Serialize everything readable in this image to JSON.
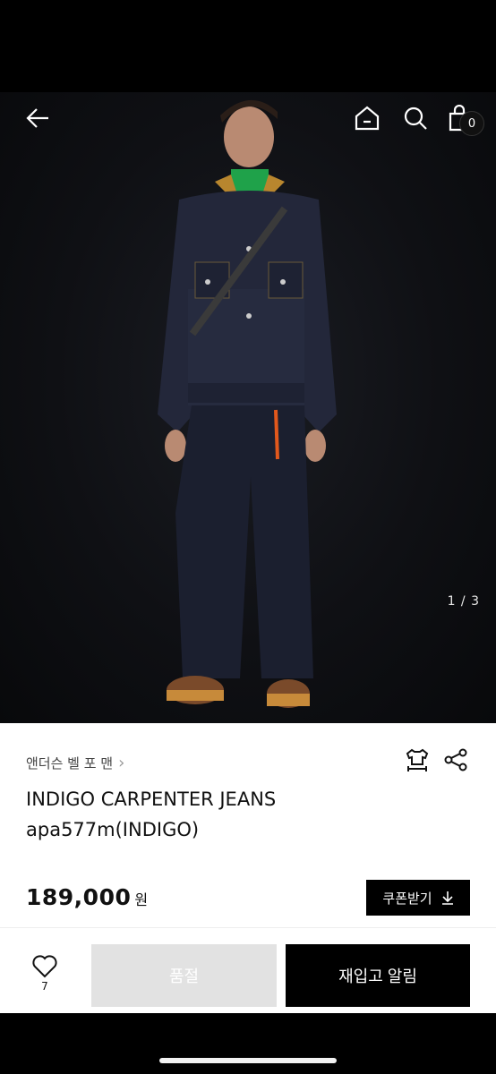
{
  "hero": {
    "pager": "1 / 3",
    "cart_count": "0"
  },
  "product": {
    "brand": "앤더슨 벨 포 맨",
    "title_line1": "INDIGO CARPENTER JEANS",
    "title_line2": "apa577m(INDIGO)",
    "price": "189,000",
    "currency": "원",
    "coupon_label": "쿠폰받기"
  },
  "bottom": {
    "like_count": "7",
    "soldout_label": "품절",
    "restock_label": "재입고 알림"
  },
  "icons": [
    "back-arrow-icon",
    "home-icon",
    "search-icon",
    "cart-icon",
    "size-guide-icon",
    "share-icon",
    "download-icon",
    "heart-icon"
  ]
}
